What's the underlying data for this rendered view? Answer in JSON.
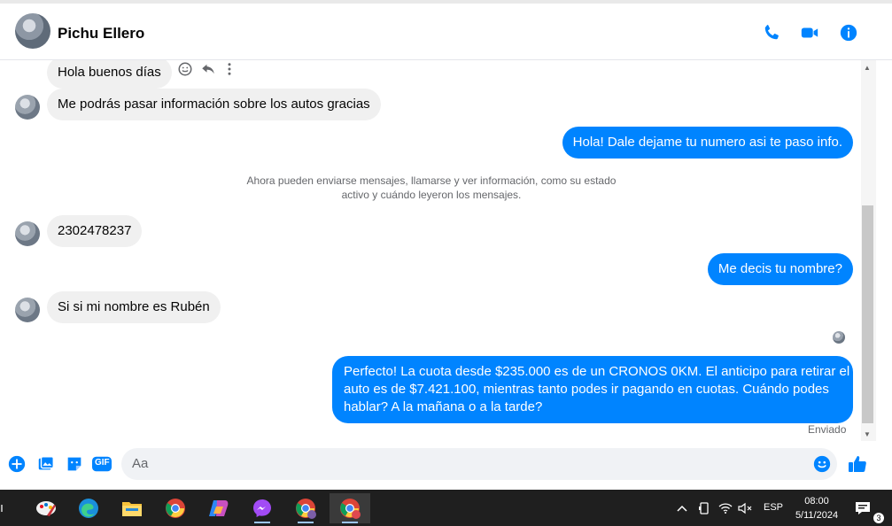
{
  "header": {
    "contact_name": "Pichu Ellero",
    "icons": [
      "phone-icon",
      "video-camera-icon",
      "info-icon"
    ]
  },
  "messages": [
    {
      "dir": "in",
      "text": "Hola buenos días"
    },
    {
      "dir": "in",
      "text": "Me podrás pasar información sobre los autos gracias"
    },
    {
      "dir": "out",
      "text": "Hola! Dale dejame tu numero  asi te paso info."
    },
    {
      "dir": "in",
      "text": "2302478237"
    },
    {
      "dir": "out",
      "text": "Me decis tu nombre?"
    },
    {
      "dir": "in",
      "text": "Si si mi nombre es Rubén"
    },
    {
      "dir": "out",
      "text_lines": [
        "Perfecto! La cuota desde $235.000 es de un CRONOS 0KM. El anticipo para retirar el",
        "auto es de $7.421.100, mientras tanto podes ir pagando en cuotas. Cuándo podes",
        "hablar? A la mañana o a la tarde?"
      ]
    }
  ],
  "system_notice": {
    "line1": "Ahora pueden enviarse mensajes, llamarse y ver información, como su estado",
    "line2": "activo y cuándo leyeron los mensajes."
  },
  "sent_label": "Enviado",
  "compose": {
    "placeholder": "Aa",
    "icons": [
      "plus-icon",
      "photo-icon",
      "sticker-icon",
      "gif-icon",
      "emoji-icon",
      "thumbs-up-icon"
    ],
    "gif_label": "GIF"
  },
  "taskbar": {
    "language": "ESP",
    "time": "08:00",
    "date": "5/11/2024",
    "notification_count": "3",
    "apps": [
      "paint-icon",
      "edge-icon",
      "file-explorer-icon",
      "chrome-icon",
      "copilot-icon",
      "messenger-icon",
      "chrome-profile-icon",
      "chrome-active-icon"
    ]
  },
  "colors": {
    "accent": "#0084ff",
    "incoming_bubble": "#f0f0f0",
    "taskbar": "#1f1f1f"
  }
}
